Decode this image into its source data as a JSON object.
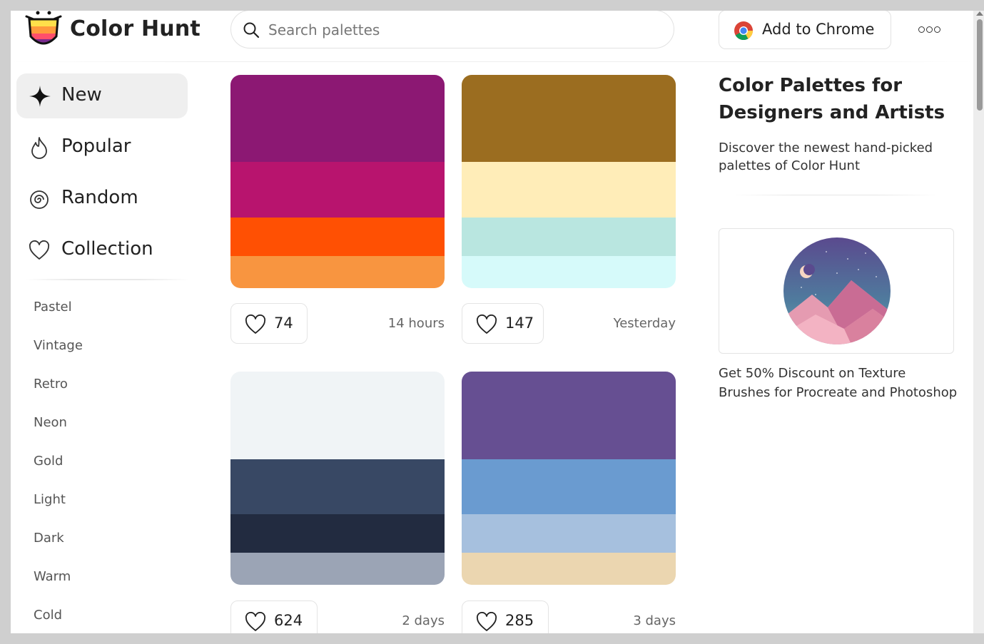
{
  "header": {
    "brand": "Color Hunt",
    "search_placeholder": "Search palettes",
    "chrome_button": "Add to Chrome",
    "more_icon": "three-circles-icon"
  },
  "sidebar": {
    "nav": [
      {
        "label": "New",
        "icon": "sparkle-icon",
        "active": true
      },
      {
        "label": "Popular",
        "icon": "flame-icon",
        "active": false
      },
      {
        "label": "Random",
        "icon": "spiral-icon",
        "active": false
      },
      {
        "label": "Collection",
        "icon": "heart-icon",
        "active": false
      }
    ],
    "tags": [
      "Pastel",
      "Vintage",
      "Retro",
      "Neon",
      "Gold",
      "Light",
      "Dark",
      "Warm",
      "Cold"
    ]
  },
  "palettes": [
    {
      "colors": [
        "#8c1873",
        "#b8146e",
        "#ff5003",
        "#f89540"
      ],
      "likes": "74",
      "time": "14 hours"
    },
    {
      "colors": [
        "#9b6d20",
        "#ffedb8",
        "#b9e6e0",
        "#d6fafa"
      ],
      "likes": "147",
      "time": "Yesterday"
    },
    {
      "colors": [
        "#f0f4f6",
        "#384864",
        "#222b40",
        "#9ba4b5"
      ],
      "likes": "624",
      "time": "2 days"
    },
    {
      "colors": [
        "#664f92",
        "#6a9bd0",
        "#a6c0de",
        "#ebd6b0"
      ],
      "likes": "285",
      "time": "3 days"
    }
  ],
  "right": {
    "title": "Color Palettes for Designers and Artists",
    "description": "Discover the newest hand-picked palettes of Color Hunt",
    "ad_text": "Get 50% Discount on Texture Brushes for Procreate and Photoshop"
  }
}
